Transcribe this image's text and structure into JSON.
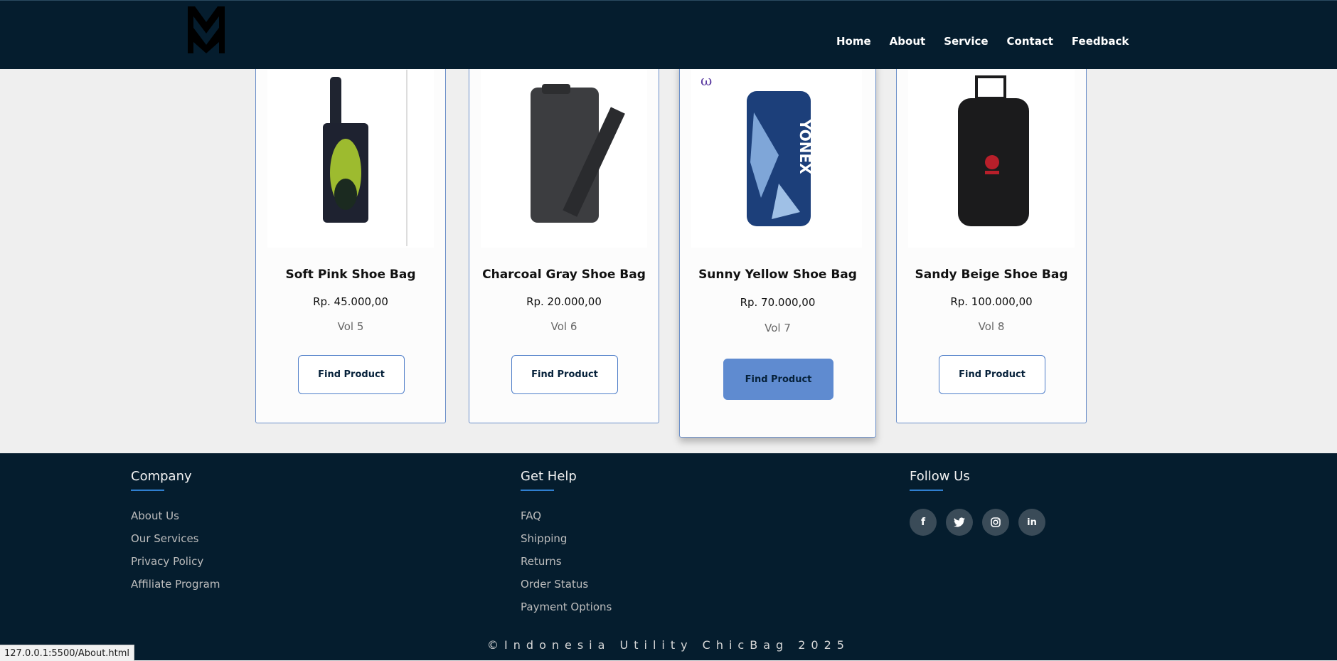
{
  "nav": {
    "logo": "M",
    "links": [
      "Home",
      "About",
      "Service",
      "Contact",
      "Feedback"
    ]
  },
  "products": [
    {
      "title": "Soft Pink Shoe Bag",
      "price": "Rp. 45.000,00",
      "vol": "Vol 5",
      "button": "Find Product"
    },
    {
      "title": "Charcoal Gray Shoe Bag",
      "price": "Rp. 20.000,00",
      "vol": "Vol 6",
      "button": "Find Product"
    },
    {
      "title": "Sunny Yellow Shoe Bag",
      "price": "Rp. 70.000,00",
      "vol": "Vol 7",
      "button": "Find Product"
    },
    {
      "title": "Sandy Beige Shoe Bag",
      "price": "Rp. 100.000,00",
      "vol": "Vol 8",
      "button": "Find Product"
    }
  ],
  "footer": {
    "company": {
      "heading": "Company",
      "items": [
        "About Us",
        "Our Services",
        "Privacy Policy",
        "Affiliate Program"
      ]
    },
    "help": {
      "heading": "Get Help",
      "items": [
        "FAQ",
        "Shipping",
        "Returns",
        "Order Status",
        "Payment Options"
      ]
    },
    "follow": {
      "heading": "Follow Us",
      "icons": [
        "facebook-icon",
        "twitter-icon",
        "instagram-icon",
        "linkedin-icon"
      ]
    },
    "copyright": "©Indonesia Utility ChicBag 2025"
  },
  "status_bar": "127.0.0.1:5500/About.html",
  "colors": {
    "nav_bg": "#051d2e",
    "accent": "#5f8bd0",
    "page_bg": "#efefef"
  }
}
